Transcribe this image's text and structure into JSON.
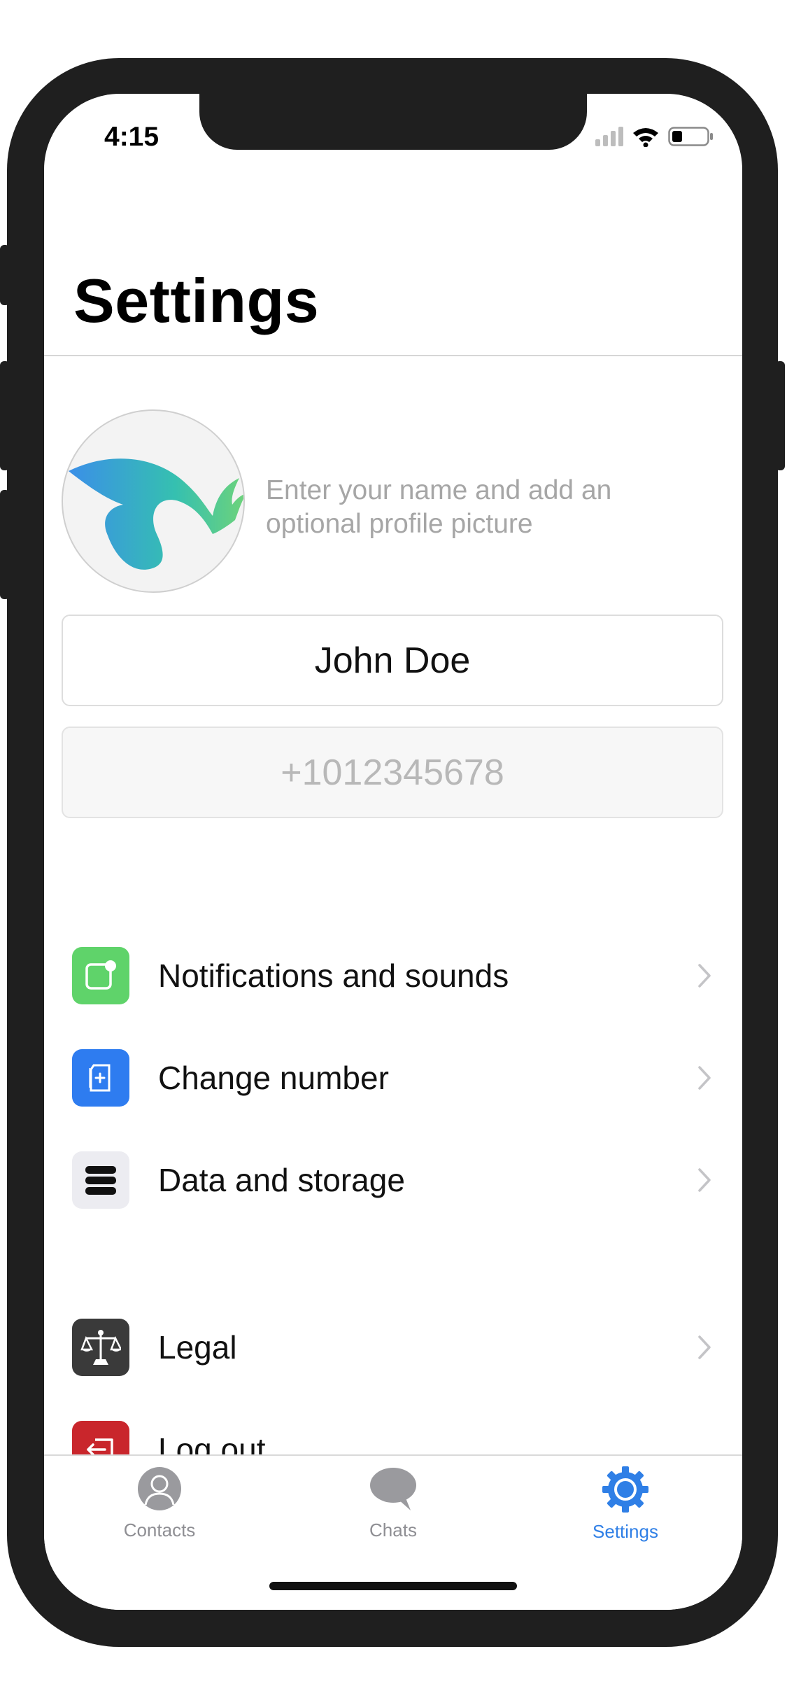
{
  "status_bar": {
    "time": "4:15"
  },
  "header": {
    "title": "Settings"
  },
  "profile": {
    "hint": "Enter your name and add an optional profile picture",
    "name_value": "John Doe",
    "phone_value": "+1012345678"
  },
  "menu": {
    "group1": [
      {
        "label": "Notifications and sounds",
        "icon": "notification-icon",
        "color": "#5fd36a"
      },
      {
        "label": "Change number",
        "icon": "sim-card-icon",
        "color": "#2e7cf0"
      },
      {
        "label": "Data and storage",
        "icon": "storage-icon",
        "color": "#ececf1"
      }
    ],
    "group2": [
      {
        "label": "Legal",
        "icon": "scales-icon",
        "color": "#3a3a3a"
      },
      {
        "label": "Log out",
        "icon": "logout-icon",
        "color": "#c9262c"
      }
    ]
  },
  "tabs": [
    {
      "label": "Contacts",
      "icon": "person-icon"
    },
    {
      "label": "Chats",
      "icon": "chat-bubble-icon"
    },
    {
      "label": "Settings",
      "icon": "gear-icon",
      "active": true
    }
  ],
  "colors": {
    "accent": "#2f7fe6",
    "inactive": "#8e8e93"
  }
}
